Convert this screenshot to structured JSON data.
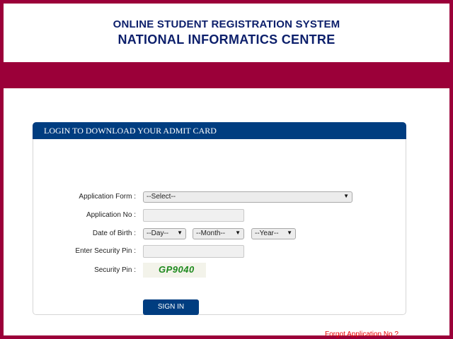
{
  "header": {
    "line1": "ONLINE STUDENT REGISTRATION SYSTEM",
    "line2": "NATIONAL INFORMATICS CENTRE"
  },
  "panel": {
    "title": "LOGIN TO DOWNLOAD YOUR ADMIT CARD",
    "fields": {
      "application_form_label": "Application Form :",
      "application_form_value": "--Select--",
      "application_no_label": "Application No :",
      "application_no_value": "",
      "dob_label": "Date of Birth :",
      "dob_day": "--Day--",
      "dob_month": "--Month--",
      "dob_year": "--Year--",
      "security_pin_input_label": "Enter Security Pin :",
      "security_pin_input_value": "",
      "security_pin_label": "Security Pin :",
      "security_pin_captcha": "GP9040"
    },
    "sign_in_label": "SIGN IN",
    "forgot_label": "Forgot Application No ?"
  },
  "colors": {
    "maroon_background": "#9b0039",
    "navy": "#003d80",
    "header_text": "#0c1f6b",
    "captcha_text": "#1e8a1e",
    "forgot_link": "#e60000"
  },
  "icons": [
    "dropdown-arrow-icon"
  ]
}
